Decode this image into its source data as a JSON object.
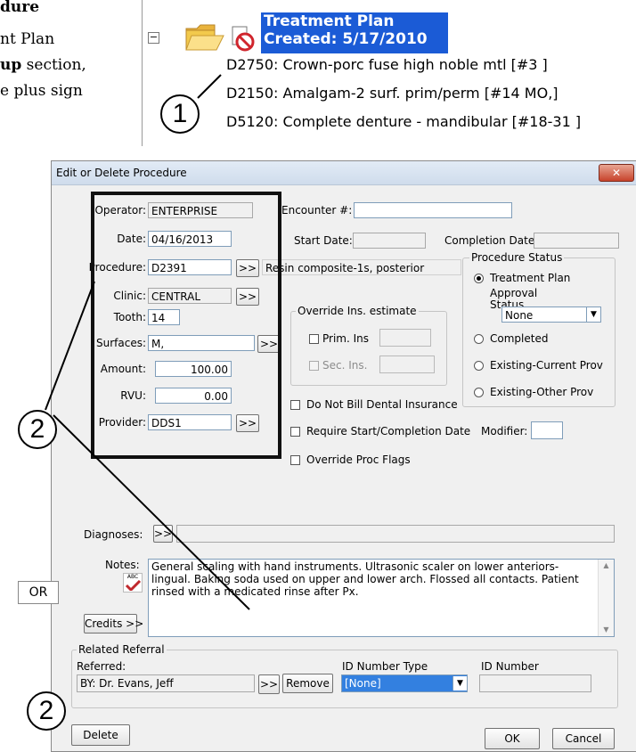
{
  "document": {
    "line1": "dure",
    "line2": "nt Plan",
    "line3_bold": "up",
    "line3_rest": " section,",
    "line4": "e plus sign"
  },
  "tree": {
    "expand_glyph": "−",
    "title_line1": "Treatment Plan",
    "title_line2": "Created: 5/17/2010",
    "items": [
      "D2750: Crown-porc fuse high noble mtl [#3 ]",
      "D2150: Amalgam-2 surf. prim/perm [#14 MO,]",
      "D5120: Complete denture - mandibular [#18-31 ]"
    ]
  },
  "callouts": {
    "one": "1",
    "two_a": "2",
    "two_b": "2",
    "or": "OR"
  },
  "dialog": {
    "title": "Edit or Delete Procedure",
    "close": "✕",
    "operator_label": "Operator:",
    "operator_value": "ENTERPRISE",
    "date_label": "Date:",
    "date_value": "04/16/2013",
    "procedure_label": "Procedure:",
    "procedure_value": "D2391",
    "procedure_desc": "Resin composite-1s, posterior",
    "clinic_label": "Clinic:",
    "clinic_value": "CENTRAL",
    "tooth_label": "Tooth:",
    "tooth_value": "14",
    "surfaces_label": "Surfaces:",
    "surfaces_value": "M,",
    "amount_label": "Amount:",
    "amount_value": "100.00",
    "rvu_label": "RVU:",
    "rvu_value": "0.00",
    "provider_label": "Provider:",
    "provider_value": "DDS1",
    "more_btn": ">>",
    "encounter_label": "Encounter #:",
    "encounter_value": "",
    "start_date_label": "Start Date:",
    "completion_date_label": "Completion Date:",
    "override_group": "Override Ins. estimate",
    "prim_ins": "Prim. Ins",
    "sec_ins": "Sec. Ins.",
    "do_not_bill": "Do Not Bill Dental Insurance",
    "require_dates": "Require Start/Completion Date",
    "modifier_label": "Modifier:",
    "override_flags": "Override Proc Flags",
    "status_group": "Procedure Status",
    "status_options": [
      "Treatment Plan",
      "Completed",
      "Existing-Current Prov",
      "Existing-Other Prov"
    ],
    "approval_label_1": "Approval",
    "approval_label_2": "Status",
    "approval_value": "None",
    "diagnoses_label": "Diagnoses:",
    "notes_label": "Notes:",
    "notes_text": "General scaling with hand instruments.  Ultrasonic scaler on lower anteriors-lingual.  Baking soda used on upper and lower arch.  Flossed all contacts.  Patient rinsed with a medicated rinse after Px.",
    "spell_icon_text": "ABC",
    "credits_btn": "Credits >>",
    "referral_group": "Related Referral",
    "referred_label": "Referred:",
    "referred_value": "BY: Dr. Evans, Jeff",
    "remove_btn": "Remove",
    "id_type_label": "ID Number Type",
    "id_type_value": "[None]",
    "id_number_label": "ID Number",
    "delete_btn": "Delete",
    "ok_btn": "OK",
    "cancel_btn": "Cancel"
  },
  "colors": {
    "selection": "#1b5bd6",
    "close_button": "#c7432b",
    "spell_check": "#c0282d"
  }
}
